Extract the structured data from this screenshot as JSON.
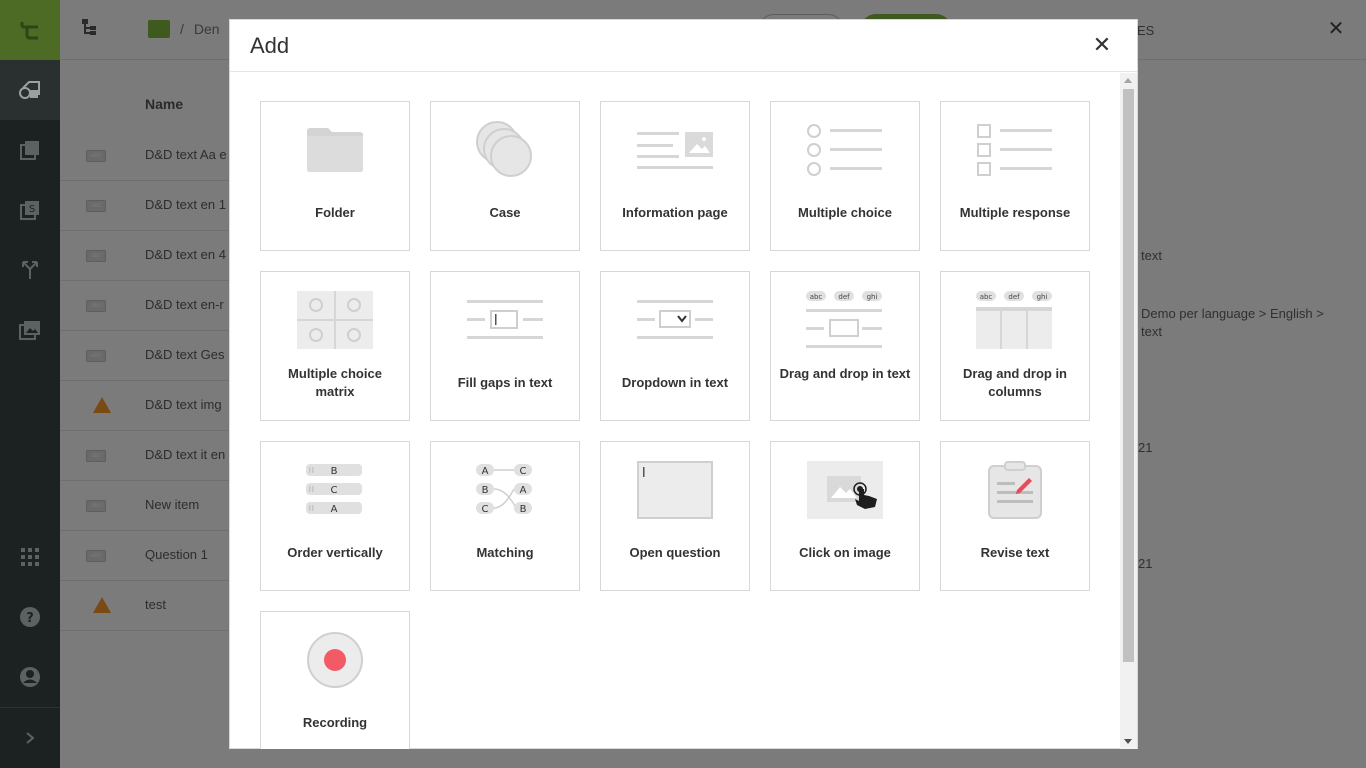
{
  "app": {
    "breadcrumb": {
      "separator": "/",
      "folder": "Den"
    },
    "right_panel": {
      "heading_fragment": "ES",
      "fragment_1": "text",
      "fragment_2_line1": "Demo per language > English >",
      "fragment_2_line2": "text",
      "fragment_3": "21",
      "fragment_4": "21"
    },
    "list": {
      "header": "Name",
      "rows": [
        {
          "label": "D&D text Aa e",
          "icon": "abc"
        },
        {
          "label": "D&D text en 1",
          "icon": "abc"
        },
        {
          "label": "D&D text en 4",
          "icon": "abc"
        },
        {
          "label": "D&D text en-r",
          "icon": "abc"
        },
        {
          "label": "D&D text Ges",
          "icon": "abc"
        },
        {
          "label": "D&D text img",
          "icon": "warning"
        },
        {
          "label": "D&D text it en",
          "icon": "abc"
        },
        {
          "label": "New item",
          "icon": "abc"
        },
        {
          "label": "Question 1",
          "icon": "abc"
        },
        {
          "label": "test",
          "icon": "warning"
        }
      ]
    }
  },
  "modal": {
    "title": "Add",
    "close_symbol": "✕",
    "tiles": [
      {
        "label": "Folder",
        "icon": "folder-icon"
      },
      {
        "label": "Case",
        "icon": "case-icon"
      },
      {
        "label": "Information page",
        "icon": "information-page-icon"
      },
      {
        "label": "Multiple choice",
        "icon": "multiple-choice-icon"
      },
      {
        "label": "Multiple response",
        "icon": "multiple-response-icon"
      },
      {
        "label": "Multiple choice matrix",
        "icon": "multiple-choice-matrix-icon"
      },
      {
        "label": "Fill gaps in text",
        "icon": "fill-gaps-icon"
      },
      {
        "label": "Dropdown in text",
        "icon": "dropdown-in-text-icon"
      },
      {
        "label": "Drag and drop in text",
        "icon": "drag-drop-text-icon"
      },
      {
        "label": "Drag and drop in columns",
        "icon": "drag-drop-columns-icon"
      },
      {
        "label": "Order vertically",
        "icon": "order-vertically-icon"
      },
      {
        "label": "Matching",
        "icon": "matching-icon"
      },
      {
        "label": "Open question",
        "icon": "open-question-icon"
      },
      {
        "label": "Click on image",
        "icon": "click-on-image-icon"
      },
      {
        "label": "Revise text",
        "icon": "revise-text-icon"
      },
      {
        "label": "Recording",
        "icon": "recording-icon"
      }
    ],
    "icon_text": {
      "order": [
        "B",
        "C",
        "A"
      ],
      "matching_left": [
        "A",
        "B",
        "C"
      ],
      "matching_right": [
        "C",
        "A",
        "B"
      ],
      "drag_tokens": [
        "abc",
        "def",
        "ghi"
      ]
    }
  },
  "colors": {
    "sidebar": "#1c2222",
    "logo_green": "#4e6b26",
    "overlay": "#7b7b7b",
    "icon_gray": "#d9d9d9",
    "record_red": "#f25a66"
  }
}
